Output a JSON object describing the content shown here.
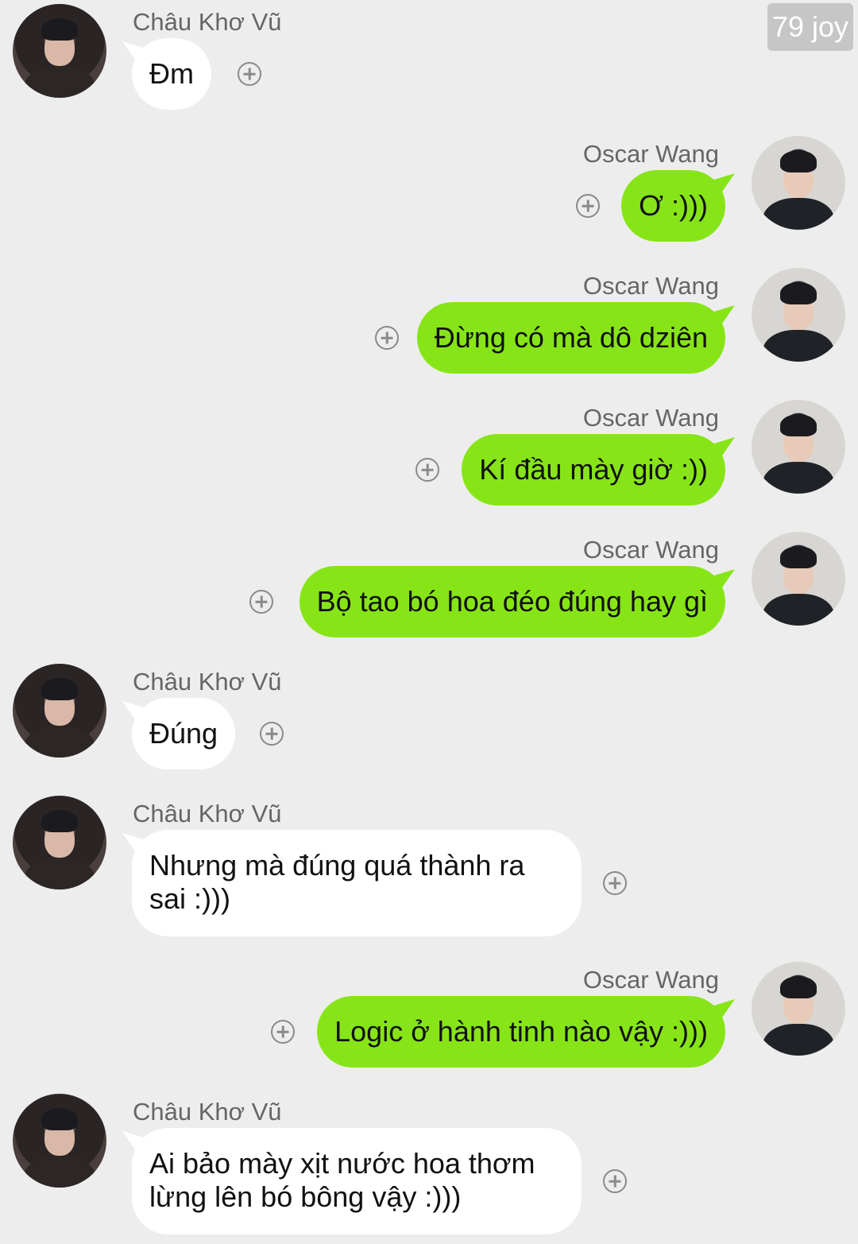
{
  "watermark": "79 joy",
  "colors": {
    "background": "#ededed",
    "bubble_in": "#ffffff",
    "bubble_out": "#87e517"
  },
  "messages": [
    {
      "sender": "Châu Khơ Vũ",
      "side": "left",
      "text": "Đm"
    },
    {
      "sender": "Oscar Wang",
      "side": "right",
      "text": "Ơ :)))"
    },
    {
      "sender": "Oscar Wang",
      "side": "right",
      "text": "Đừng có mà dô dziên"
    },
    {
      "sender": "Oscar Wang",
      "side": "right",
      "text": "Kí đầu mày giờ :))"
    },
    {
      "sender": "Oscar Wang",
      "side": "right",
      "text": "Bộ tao bó hoa đéo đúng hay gì"
    },
    {
      "sender": "Châu Khơ Vũ",
      "side": "left",
      "text": "Đúng"
    },
    {
      "sender": "Châu Khơ Vũ",
      "side": "left",
      "text": "Nhưng mà đúng quá thành ra sai :)))"
    },
    {
      "sender": "Oscar Wang",
      "side": "right",
      "text": "Logic ở hành tinh nào vậy :)))"
    },
    {
      "sender": "Châu Khơ Vũ",
      "side": "left",
      "text": "Ai bảo mày xịt nước hoa thơm lừng lên bó bông vậy :)))"
    }
  ],
  "icons": {
    "add_reaction": "plus-circle-icon",
    "avatar": "avatar-photo"
  }
}
